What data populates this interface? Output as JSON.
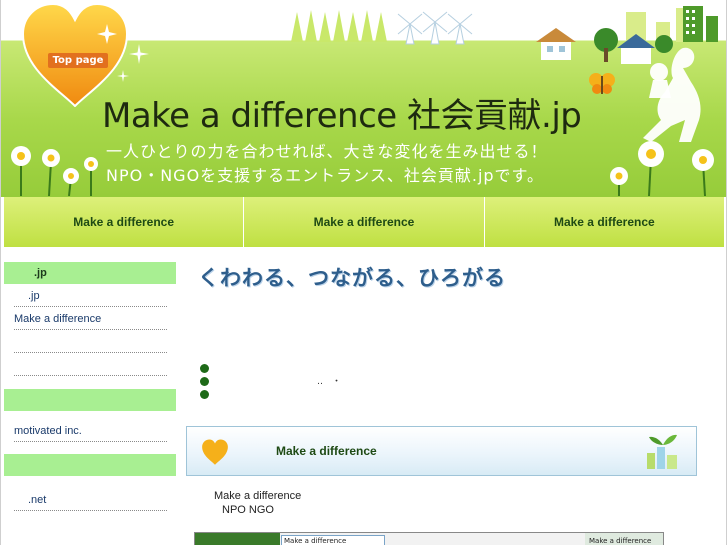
{
  "header": {
    "top_button": "Top page",
    "site_title": "Make a difference 社会貢献.jp",
    "tagline_1": "一人ひとりの力を合わせれば、大きな変化を生み出せる！",
    "tagline_2": "NPO・NGOを支援するエントランス、社会貢献.jpです。"
  },
  "nav": {
    "items": [
      "Make a difference",
      "Make a difference",
      "Make a difference"
    ]
  },
  "sidebar": {
    "section_1_heading": ".jp",
    "section_1_links": [
      ".jp",
      "Make a difference",
      "",
      ""
    ],
    "section_2_links": [
      "motivated inc."
    ],
    "section_3_links": [
      ".net"
    ]
  },
  "main": {
    "catchphrase": "くわわる、つながる、ひろがる",
    "dots_text": "‥　・",
    "banner_title": "Make a difference",
    "body_line_1": "Make a difference",
    "body_line_2": "NPO NGO",
    "screenshot": {
      "search_value": "Make a difference",
      "right_label": "Make a difference"
    }
  },
  "colors": {
    "header_green": "#a8d84a",
    "nav_green": "#c9e85a",
    "sidebar_heading": "#a8ef92",
    "link_blue": "#1a3a6a",
    "heart_orange": "#f5a01a",
    "top_button": "#e2701e",
    "catch_blue": "#2e5e8c"
  }
}
